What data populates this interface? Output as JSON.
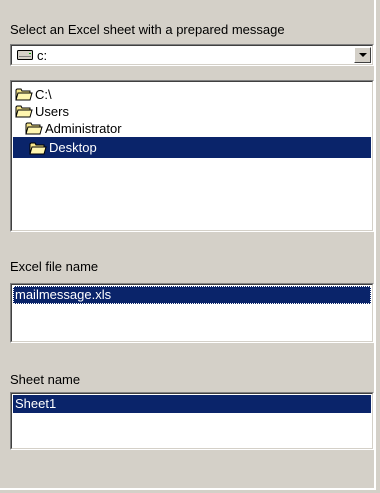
{
  "sheet_section": {
    "title": "Select an Excel sheet with a prepared message"
  },
  "drive": {
    "value": "c:",
    "icon": "drive-icon"
  },
  "directories": [
    {
      "label": "C:\\",
      "icon": "open-folder-icon"
    },
    {
      "label": "Users",
      "icon": "open-folder-icon"
    },
    {
      "label": "Administrator",
      "icon": "open-folder-icon"
    },
    {
      "label": "Desktop",
      "icon": "open-folder-icon",
      "selected": true
    }
  ],
  "file_section": {
    "label": "Excel file name",
    "files": [
      "mailmessage.xls"
    ]
  },
  "sheet_name_section": {
    "label": "Sheet name",
    "sheets": [
      "Sheet1"
    ]
  },
  "colors": {
    "selection": "#0a246a",
    "face": "#d4d0c8",
    "folder": "#f6e68c"
  }
}
